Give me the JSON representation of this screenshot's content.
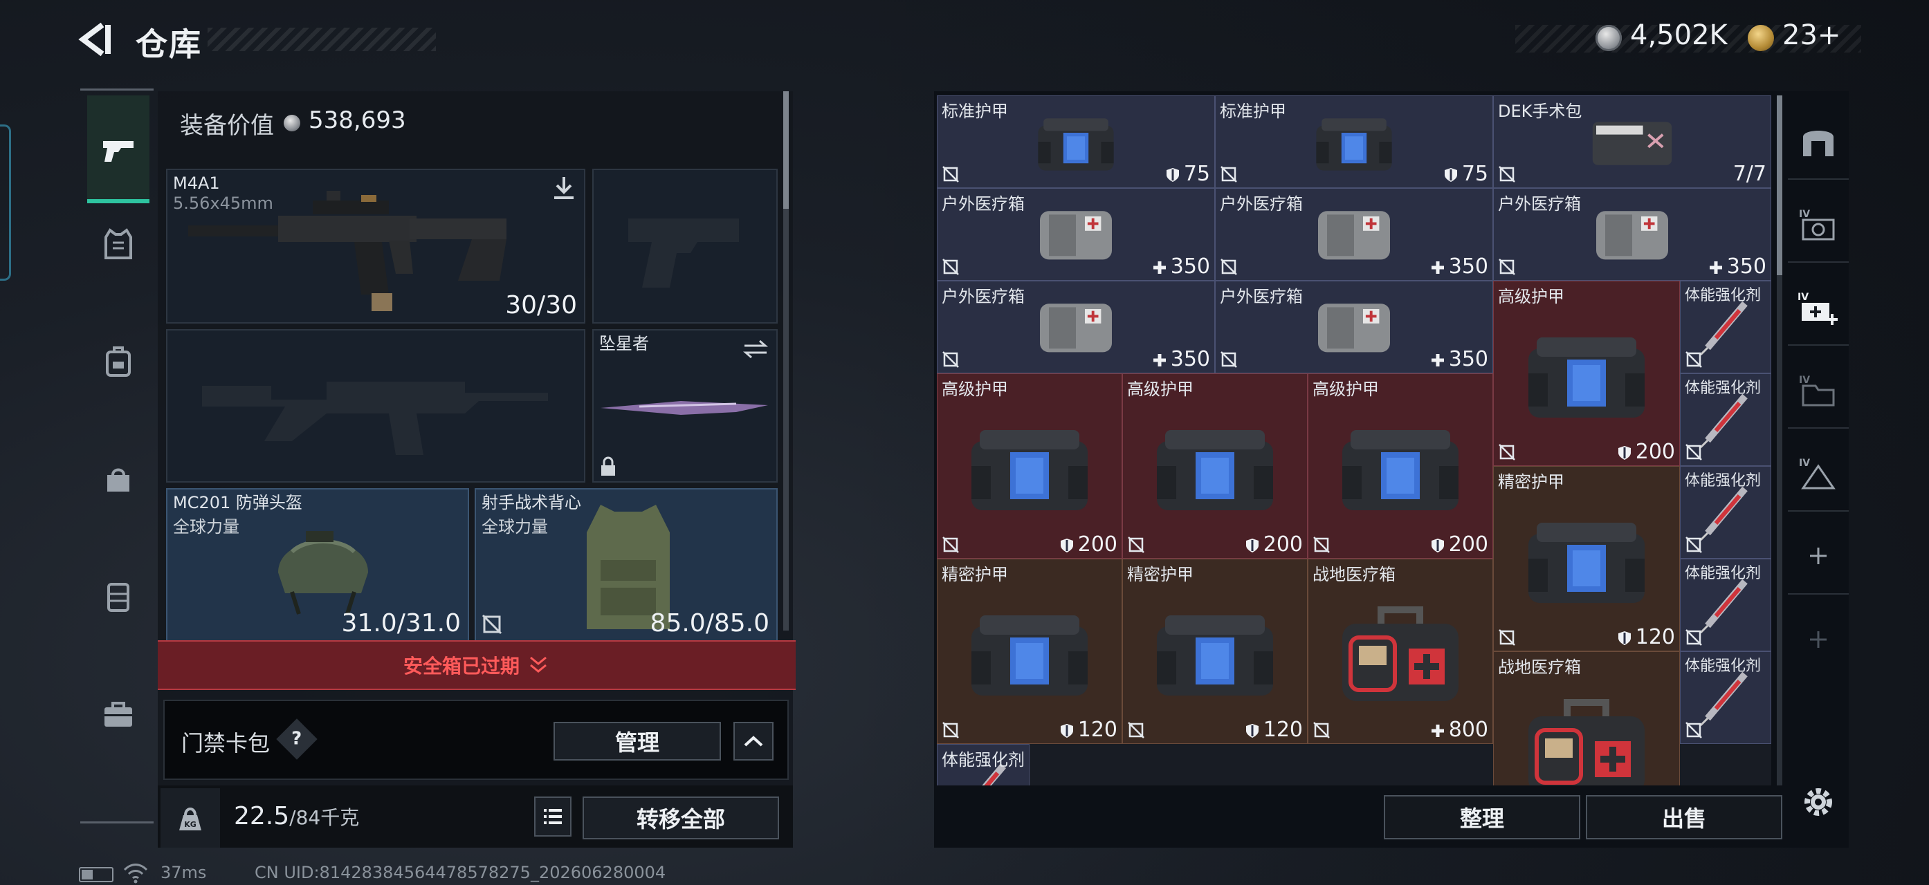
{
  "header": {
    "title": "仓库",
    "currency_silver": "4,502K",
    "currency_gold": "23",
    "currency_gold_plus": "+"
  },
  "equipment": {
    "value_label": "装备价值",
    "value": "538,693",
    "primary": {
      "name": "M4A1",
      "caliber": "5.56x45mm",
      "ammo": "30/30"
    },
    "melee": {
      "name": "坠星者"
    },
    "helmet": {
      "name": "MC201 防弹头盔",
      "faction": "全球力量",
      "durability": "31.0/31.0"
    },
    "vest": {
      "name": "射手战术背心",
      "faction": "全球力量",
      "durability": "85.0/85.0"
    },
    "safebox_status": "安全箱已过期",
    "keybag_label": "门禁卡包",
    "help_label": "?",
    "manage_label": "管理",
    "weight_value": "22.5",
    "weight_max": "/84千克",
    "transfer_all_label": "转移全部"
  },
  "stash": {
    "items": [
      {
        "name": "标准护甲",
        "value": "75",
        "icon": "shield",
        "kind": "bag",
        "col": 0,
        "row": 0,
        "w": 1,
        "h": 1,
        "bg": "normal"
      },
      {
        "name": "标准护甲",
        "value": "75",
        "icon": "shield",
        "kind": "bag",
        "col": 1,
        "row": 0,
        "w": 1,
        "h": 1,
        "bg": "normal"
      },
      {
        "name": "DEK手术包",
        "value": "7/7",
        "icon": "",
        "kind": "pouch",
        "col": 2,
        "row": 0,
        "w": 1,
        "h": 1,
        "bg": "normal"
      },
      {
        "name": "户外医疗箱",
        "value": "350",
        "icon": "plus",
        "kind": "medbag",
        "col": 0,
        "row": 1,
        "w": 1,
        "h": 1,
        "bg": "normal"
      },
      {
        "name": "户外医疗箱",
        "value": "350",
        "icon": "plus",
        "kind": "medbag",
        "col": 1,
        "row": 1,
        "w": 1,
        "h": 1,
        "bg": "normal"
      },
      {
        "name": "户外医疗箱",
        "value": "350",
        "icon": "plus",
        "kind": "medbag",
        "col": 2,
        "row": 1,
        "w": 1,
        "h": 1,
        "bg": "normal"
      },
      {
        "name": "户外医疗箱",
        "value": "350",
        "icon": "plus",
        "kind": "medbag",
        "col": 0,
        "row": 2,
        "w": 1,
        "h": 1,
        "bg": "normal"
      },
      {
        "name": "户外医疗箱",
        "value": "350",
        "icon": "plus",
        "kind": "medbag",
        "col": 1,
        "row": 2,
        "w": 1,
        "h": 1,
        "bg": "normal"
      },
      {
        "name": "高级护甲",
        "value": "200",
        "icon": "shield",
        "kind": "bigbag",
        "col": 2,
        "row": 2,
        "w": 1,
        "h": 2,
        "bg": "red"
      },
      {
        "name": "高级护甲",
        "value": "200",
        "icon": "shield",
        "kind": "bigbag",
        "col": 0,
        "row": 3,
        "w": 1,
        "h": 2,
        "bg": "red",
        "narrow": true,
        "ncol": 0
      },
      {
        "name": "高级护甲",
        "value": "200",
        "icon": "shield",
        "kind": "bigbag",
        "col": 1,
        "row": 3,
        "w": 1,
        "h": 2,
        "bg": "red",
        "narrow": true,
        "ncol": 1
      },
      {
        "name": "高级护甲",
        "value": "200",
        "icon": "shield",
        "kind": "bigbag",
        "col": 2,
        "row": 3,
        "w": 1,
        "h": 2,
        "bg": "red",
        "narrow": true,
        "ncol": 2
      },
      {
        "name": "精密护甲",
        "value": "120",
        "icon": "shield",
        "kind": "bag",
        "col": 2,
        "row": 4,
        "w": 1,
        "h": 2,
        "bg": "brown"
      },
      {
        "name": "精密护甲",
        "value": "120",
        "icon": "shield",
        "kind": "bag",
        "col": 0,
        "row": 5,
        "w": 1,
        "h": 2,
        "bg": "brown",
        "narrow": true,
        "ncol": 0
      },
      {
        "name": "精密护甲",
        "value": "120",
        "icon": "shield",
        "kind": "bag",
        "col": 1,
        "row": 5,
        "w": 1,
        "h": 2,
        "bg": "brown",
        "narrow": true,
        "ncol": 1
      },
      {
        "name": "战地医疗箱",
        "value": "800",
        "icon": "plus",
        "kind": "firstaid",
        "col": 2,
        "row": 5,
        "w": 1,
        "h": 2,
        "bg": "brown",
        "narrow": true,
        "ncol": 2
      },
      {
        "name": "战地医疗箱",
        "value": "",
        "icon": "",
        "kind": "firstaid",
        "col": 2,
        "row": 6,
        "w": 1,
        "h": 2,
        "bg": "brown"
      },
      {
        "name": "体能强化剂",
        "value": "",
        "icon": "",
        "kind": "syringe",
        "col": 0,
        "row": 7,
        "w": 1,
        "h": 1,
        "bg": "normal"
      }
    ],
    "syringe_column": [
      {
        "name": "体能强化剂"
      },
      {
        "name": "体能强化剂"
      },
      {
        "name": "体能强化剂"
      },
      {
        "name": "体能强化剂"
      },
      {
        "name": "体能强化剂"
      }
    ],
    "sort_label": "整理",
    "sell_label": "出售"
  },
  "status": {
    "ping": "37ms",
    "uid": "CN UID:81428384564478578275_202606280004"
  },
  "colors": {
    "accent": "#2ec4a0",
    "danger": "#ff5a5a",
    "rare_bg": "#4a2026",
    "epic_bg": "#3b2a22",
    "common_bg": "#2a2f44"
  }
}
